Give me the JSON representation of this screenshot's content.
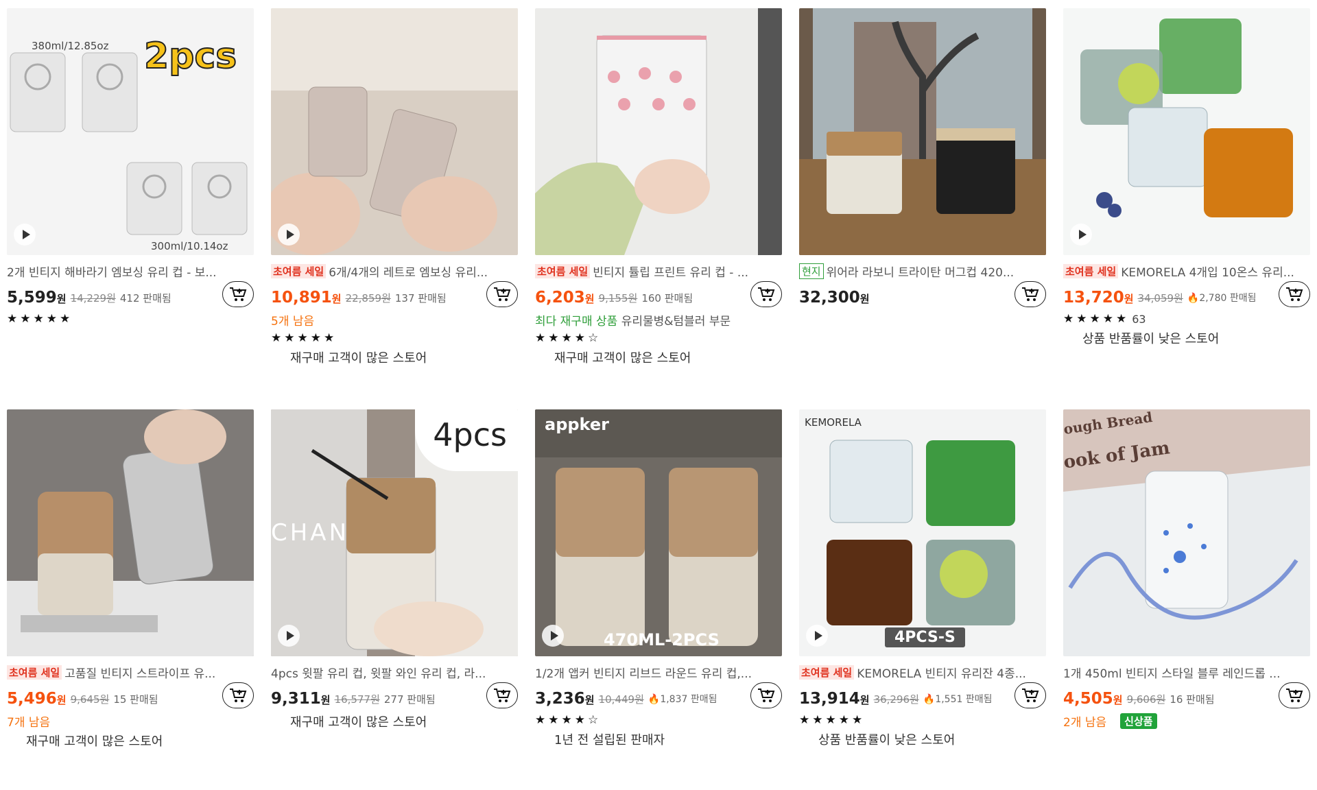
{
  "products": [
    {
      "title": "2개 빈티지 해바라기 엠보싱 유리 컵 - 보...",
      "sale_badge": "",
      "price": "5,599",
      "won": "원",
      "orig_price": "14,229원",
      "sold": "412 판매됨",
      "stock": "",
      "tagline": "",
      "stars": "★★★★★",
      "rating_count": "",
      "store": "",
      "overlay": [
        "380ml/12.85oz",
        "2pcs",
        "300ml/10.14oz"
      ]
    },
    {
      "title": "6개/4개의 레트로 엠보싱 유리...",
      "sale_badge": "초여름 세일",
      "price": "10,891",
      "won": "원",
      "orig_price": "22,859원",
      "sold": "137 판매됨",
      "stock": "5개 남음",
      "tagline": "",
      "stars": "★★★★★",
      "rating_count": "",
      "store": "재구매 고객이 많은 스토어",
      "overlay": []
    },
    {
      "title": "빈티지 튤립 프린트 유리 컵 - ...",
      "sale_badge": "초여름 세일",
      "price": "6,203",
      "won": "원",
      "orig_price": "9,155원",
      "sold": "160 판매됨",
      "stock": "",
      "tagline_green": "최다 재구매 상품",
      "tagline": "유리물병&텀블러 부문",
      "stars": "★★★★☆",
      "rating_count": "",
      "store": "재구매 고객이 많은 스토어",
      "overlay": []
    },
    {
      "title": "위어라 라보니 트라이탄 머그컵 420...",
      "local_badge": "현지",
      "sale_badge": "",
      "price": "32,300",
      "won": "원",
      "orig_price": "",
      "sold": "",
      "stock": "",
      "tagline": "",
      "stars": "",
      "rating_count": "",
      "store": "",
      "overlay": []
    },
    {
      "title": "KEMORELA 4개입 10온스 유리...",
      "sale_badge": "초여름 세일",
      "price": "13,720",
      "won": "원",
      "orig_price": "34,059원",
      "hot": "2,780 판매됨",
      "sold": "",
      "stock": "",
      "tagline": "",
      "stars": "★★★★★",
      "rating_count": "63",
      "store": "상품 반품률이 낮은 스토어",
      "overlay": []
    },
    {
      "title": "고품질 빈티지 스트라이프 유...",
      "sale_badge": "초여름 세일",
      "price": "5,496",
      "won": "원",
      "orig_price": "9,645원",
      "sold": "15 판매됨",
      "stock": "7개 남음",
      "tagline": "",
      "stars": "",
      "rating_count": "",
      "store": "재구매 고객이 많은 스토어",
      "overlay": []
    },
    {
      "title": "4pcs 윗팔 유리 컵, 윗팔 와인 유리 컵, 라...",
      "sale_badge": "",
      "price": "9,311",
      "won": "원",
      "orig_price": "16,577원",
      "sold": "277 판매됨",
      "stock": "",
      "tagline": "",
      "stars": "",
      "rating_count": "",
      "store": "재구매 고객이 많은 스토어",
      "overlay": [
        "4pcs",
        "CHAN"
      ]
    },
    {
      "title": "1/2개 앱커 빈티지 리브드 라운드 유리 컵,...",
      "sale_badge": "",
      "price": "3,236",
      "won": "원",
      "orig_price": "10,449원",
      "hot": "1,837 판매됨",
      "sold": "",
      "stock": "",
      "tagline": "",
      "stars": "★★★★☆",
      "rating_count": "",
      "store": "1년 전 설립된 판매자",
      "overlay": [
        "appker",
        "470ML-2PCS"
      ]
    },
    {
      "title": "KEMORELA 빈티지 유리잔 4종...",
      "sale_badge": "초여름 세일",
      "price": "13,914",
      "won": "원",
      "orig_price": "36,296원",
      "hot": "1,551 판매됨",
      "sold": "",
      "stock": "",
      "tagline": "",
      "stars": "★★★★★",
      "rating_count": "",
      "store": "상품 반품률이 낮은 스토어",
      "overlay": [
        "KEMORELA",
        "4PCS-S"
      ]
    },
    {
      "title": "1개 450ml 빈티지 스타일 블루 레인드롭 ...",
      "sale_badge": "",
      "price": "4,505",
      "won": "원",
      "orig_price": "9,606원",
      "sold": "16 판매됨",
      "stock": "2개 남음",
      "new_badge": "신상품",
      "tagline": "",
      "stars": "",
      "rating_count": "",
      "store": "",
      "overlay": [
        "ough Bread",
        "ook of Jam"
      ]
    }
  ],
  "colors": {
    "accent_price": "#f5520f",
    "sale_bg": "#fde6e3",
    "sale_fg": "#e0321f",
    "green": "#2f9e3a",
    "orange": "#f5720f"
  },
  "icons": {
    "cart": "cart-plus-icon",
    "play": "play-icon",
    "flame": "flame-icon"
  }
}
